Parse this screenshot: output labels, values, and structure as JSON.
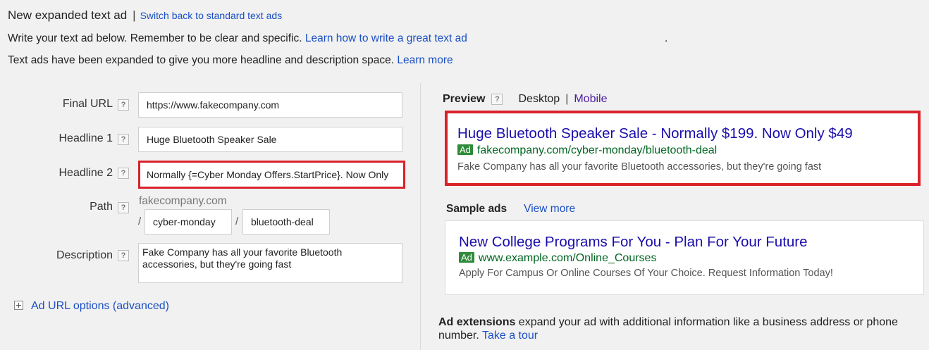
{
  "header": {
    "title": "New expanded text ad",
    "separator": "|",
    "switch_link": "Switch back to standard text ads"
  },
  "intro": {
    "line1_text": "Write your text ad below. Remember to be clear and specific.",
    "line1_link": "Learn how to write a great text ad",
    "line1_trailing": ".",
    "line2_text": "Text ads have been expanded to give you more headline and description space.",
    "line2_link": "Learn more"
  },
  "form": {
    "help_glyph": "?",
    "final_url": {
      "label": "Final URL",
      "value": "https://www.fakecompany.com"
    },
    "headline1": {
      "label": "Headline 1",
      "value": "Huge Bluetooth Speaker Sale"
    },
    "headline2": {
      "label": "Headline 2",
      "value": "Normally {=Cyber Monday Offers.StartPrice}. Now Only"
    },
    "path": {
      "label": "Path",
      "domain": "fakecompany.com",
      "slash": "/",
      "path1": "cyber-monday",
      "path2": "bluetooth-deal"
    },
    "description": {
      "label": "Description",
      "value": "Fake Company has all your favorite Bluetooth accessories, but they're going fast"
    },
    "advanced_link": "Ad URL options (advanced)"
  },
  "preview": {
    "title": "Preview",
    "desktop": "Desktop",
    "separator": "|",
    "mobile": "Mobile",
    "ad": {
      "headline": "Huge Bluetooth Speaker Sale - Normally $199. Now Only $49",
      "badge": "Ad",
      "url": "fakecompany.com/cyber-monday/bluetooth-deal",
      "description": "Fake Company has all your favorite Bluetooth accessories, but they're going fast"
    }
  },
  "sample_ads": {
    "title": "Sample ads",
    "view_more": "View more",
    "ad": {
      "headline": "New College Programs For You - Plan For Your Future",
      "badge": "Ad",
      "url": "www.example.com/Online_Courses",
      "description": "Apply For Campus Or Online Courses Of Your Choice. Request Information Today!"
    }
  },
  "extensions": {
    "bold": "Ad extensions",
    "text": " expand your ad with additional information like a business address or phone number.",
    "link": "Take a tour"
  },
  "colors": {
    "highlight_border": "#d9222a",
    "link_blue": "#1a4fc4",
    "ad_headline": "#1a0dab",
    "ad_url_green": "#006621",
    "ad_badge_green": "#2f8a3a"
  }
}
